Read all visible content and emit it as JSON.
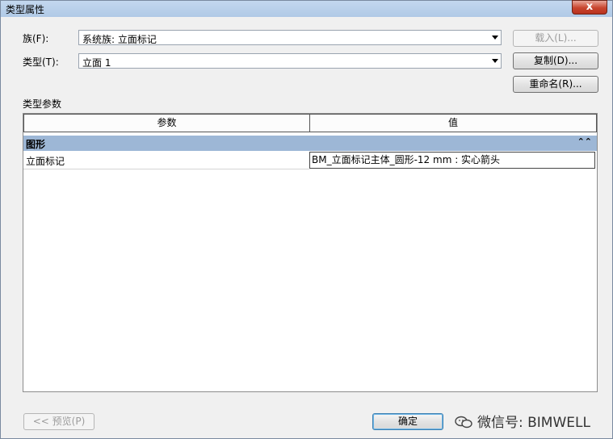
{
  "window": {
    "title": "类型属性",
    "close_glyph": "x"
  },
  "family": {
    "label": "族(F):",
    "value": "系统族: 立面标记"
  },
  "type": {
    "label": "类型(T):",
    "value": "立面 1"
  },
  "buttons": {
    "load": "载入(L)...",
    "duplicate": "复制(D)...",
    "rename": "重命名(R)...",
    "preview": "<< 预览(P)",
    "ok": "确定"
  },
  "type_parameters": {
    "heading": "类型参数",
    "columns": [
      "参数",
      "值"
    ],
    "group": {
      "name": "图形",
      "collapse_glyph": "⌃⌃"
    },
    "rows": [
      {
        "name": "立面标记",
        "value": "BM_立面标记主体_圆形-12 mm : 实心箭头"
      }
    ]
  },
  "watermark": {
    "text": "微信号: BIMWELL",
    "icon": "wechat-icon"
  },
  "colors": {
    "group_header": "#9db7d6",
    "dialog_bg": "#f0f0f0",
    "close_red": "#c8452e"
  }
}
